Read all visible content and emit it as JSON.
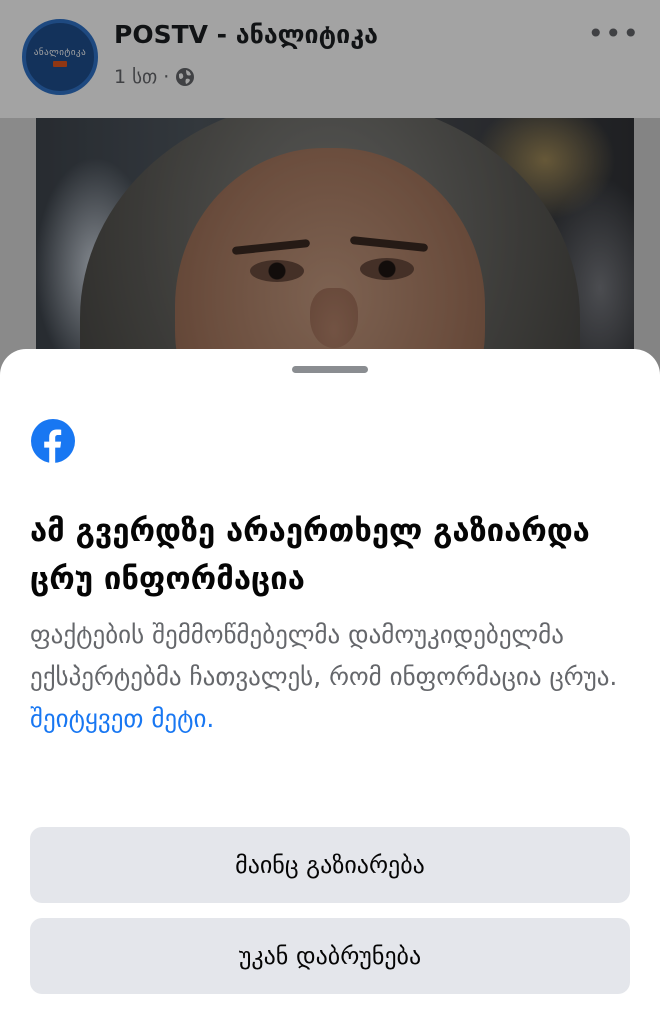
{
  "post": {
    "page_name": "POSTV - ანალიტიკა",
    "time": "1 სთ",
    "separator": "·",
    "more_icon": "more-horizontal-icon",
    "more_glyph": "•••",
    "avatar_text": "ანალიტიკა",
    "privacy_icon": "globe-icon"
  },
  "sheet": {
    "brand_icon": "facebook-logo-icon",
    "title": "ამ გვერდზე არაერთხელ გაზიარდა ცრუ ინფორმაცია",
    "body": "ფაქტების შემმოწმებელმა დამოუკიდებელმა ექსპერტებმა ჩათვალეს, რომ ინფორმაცია ცრუა.",
    "learn_more": "შეიტყვეთ მეტი.",
    "share_anyway_label": "მაინც გაზიარება",
    "go_back_label": "უკან დაბრუნება"
  },
  "colors": {
    "facebook_blue": "#1877f2",
    "button_bg": "#e4e6eb",
    "secondary_text": "#65676b"
  }
}
